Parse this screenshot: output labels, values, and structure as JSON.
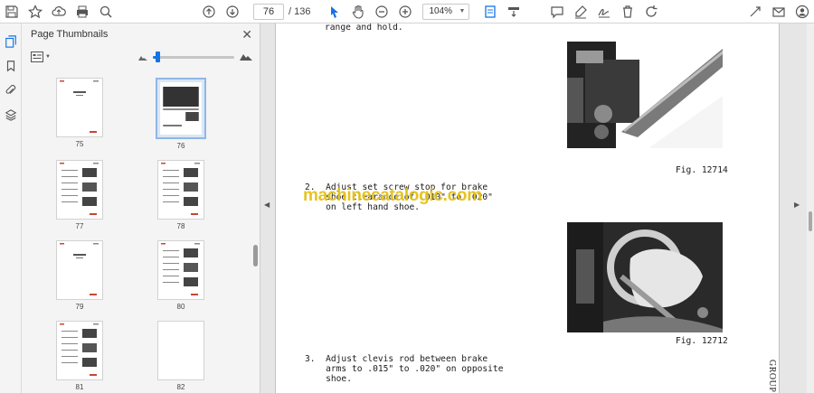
{
  "toolbar": {
    "page_current": "76",
    "page_total": "/ 136",
    "zoom": "104%",
    "icons_left": [
      "save-icon",
      "bookmark-star-icon",
      "upload-icon",
      "print-icon",
      "zoom-search-icon"
    ],
    "icons_nav": [
      "page-up-icon",
      "page-down-icon"
    ],
    "icons_tools": [
      "select-arrow-icon",
      "hand-icon",
      "zoom-out-icon",
      "zoom-in-icon"
    ],
    "icons_right": [
      "comment-icon",
      "highlight-pen-icon",
      "sign-icon",
      "delete-icon",
      "rotate-icon",
      "share-link-icon",
      "email-icon",
      "account-icon"
    ]
  },
  "rail": [
    "thumbnails-icon",
    "bookmarks-icon",
    "attachments-icon",
    "layers-icon"
  ],
  "panel": {
    "title": "Page Thumbnails",
    "thumb_size_fraction": 0.05,
    "thumbnails": [
      {
        "label": "75",
        "selected": false
      },
      {
        "label": "76",
        "selected": true
      },
      {
        "label": "77",
        "selected": false
      },
      {
        "label": "78",
        "selected": false
      },
      {
        "label": "79",
        "selected": false
      },
      {
        "label": "80",
        "selected": false
      },
      {
        "label": "81",
        "selected": false
      },
      {
        "label": "82",
        "selected": false
      }
    ]
  },
  "document": {
    "line_top": "range and hold.",
    "step2_line1": "2.  Adjust set screw stop for brake",
    "step2_line2": "    shoe clearance of .010\" to .020\"",
    "step2_line3": "    on left hand shoe.",
    "fig1": "Fig. 12714",
    "fig2": "Fig. 12712",
    "step3_line1": "3.  Adjust clevis rod between brake",
    "step3_line2": "    arms to .015\" to .020\" on opposite",
    "step3_line3": "    shoe.",
    "side_label": "GROUP",
    "watermark": "machinecatalogic.com"
  }
}
